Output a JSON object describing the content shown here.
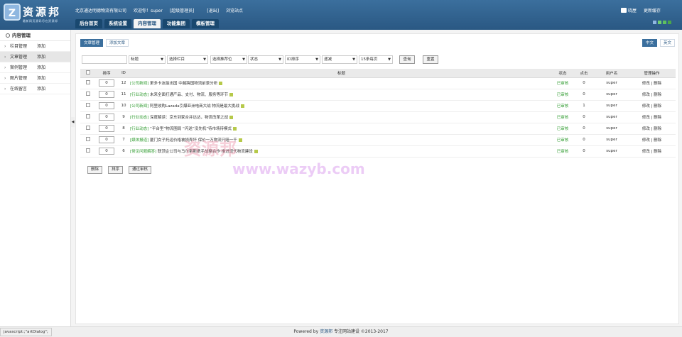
{
  "header": {
    "logo_text": "资源邦",
    "logo_mark": "Z",
    "slogan": "最新网页源码尽在资源邦",
    "company": "北京通达明德物流有限公司",
    "welcome": "欢迎你！super",
    "role": "[超级管理员]",
    "logout": "[退出]",
    "browse_site": "浏览站点",
    "right_home": "晓屋",
    "right_cache": "更新缓存"
  },
  "nav": {
    "tabs": [
      "后台首页",
      "系统设置",
      "内容管理",
      "功能集团",
      "模板管理"
    ]
  },
  "sidebar": {
    "title": "内容管理",
    "items": [
      {
        "label": "栏目管理",
        "add": "添加"
      },
      {
        "label": "文章管理",
        "add": "添加"
      },
      {
        "label": "案例管理",
        "add": "添加"
      },
      {
        "label": "图片管理",
        "add": "添加"
      },
      {
        "label": "在线留言",
        "add": "添加"
      }
    ]
  },
  "subtabs": [
    "文章管理",
    "添加文章"
  ],
  "lang": [
    "中文",
    "英文"
  ],
  "filters": {
    "f1": "标题",
    "f2": "选择栏目",
    "f3": "选择推荐位",
    "f4": "状态",
    "f5": "ID排序",
    "f6": "递减",
    "f7": "15条每页",
    "search": "查询",
    "reset": "重置"
  },
  "table": {
    "headers": {
      "sort": "排序",
      "id": "ID",
      "title": "标题",
      "status": "状态",
      "hits": "点击",
      "user": "用户名",
      "ops": "管理操作"
    },
    "rows": [
      {
        "sort": "0",
        "id": "12",
        "cat": "[公司新闻]",
        "title": "更多卡友能出国 中越跨国物流前景分析",
        "status": "已审核",
        "hits": "0",
        "user": "super",
        "ops": "修改 | 删除"
      },
      {
        "sort": "0",
        "id": "11",
        "cat": "[行业动态]",
        "title": "未来全面打通产品、支付、物流、服务等环节",
        "status": "已审核",
        "hits": "0",
        "user": "super",
        "ops": "修改 | 删除"
      },
      {
        "sort": "0",
        "id": "10",
        "cat": "[公司新闻]",
        "title": "阿里收购Lazada引爆亚洲电商大战 物流是最大挑战",
        "status": "已审核",
        "hits": "1",
        "user": "super",
        "ops": "修改 | 删除"
      },
      {
        "sort": "0",
        "id": "9",
        "cat": "[行业动态]",
        "title": "深度解读：京东到家合并达达，物流改革之战",
        "status": "已审核",
        "hits": "0",
        "user": "super",
        "ops": "修改 | 删除"
      },
      {
        "sort": "0",
        "id": "8",
        "cat": "[行业动态]",
        "title": "“平台型”物流围局 “闪送”没先机”待市场待模式",
        "status": "已审核",
        "hits": "0",
        "user": "super",
        "ops": "修改 | 删除"
      },
      {
        "sort": "0",
        "id": "7",
        "cat": "[媒体报道]",
        "title": "厦门女子托运价格被损弄坏 保价一万物流只赔一千",
        "status": "已审核",
        "hits": "0",
        "user": "super",
        "ops": "修改 | 删除"
      },
      {
        "sort": "0",
        "id": "6",
        "cat": "[常见问题解答]",
        "title": "联顶企公司与马尔索斯携手战略合作 推进现代物流建设",
        "status": "已审核",
        "hits": "0",
        "user": "super",
        "ops": "修改 | 删除"
      }
    ]
  },
  "bottom_buttons": [
    "删除",
    "排序",
    "通过审核"
  ],
  "watermark": {
    "line1": "资源邦",
    "line2": "www.wazyb.com"
  },
  "footer": {
    "powered": "Powered by",
    "brand": "资源邦",
    "tail": "专注网站建设 ©2013-2017"
  },
  "statusbar": "javascript:;\"artDialog\";"
}
